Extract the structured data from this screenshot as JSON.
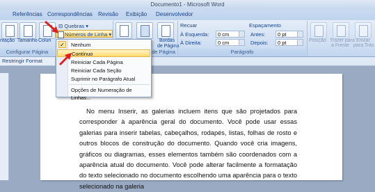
{
  "window": {
    "title": "Documento1 - Microsoft Word"
  },
  "tabs": [
    "Referências",
    "Correspondências",
    "Revisão",
    "Exibição",
    "Desenvolvedor"
  ],
  "ribbon": {
    "quebras_label": "Quebras",
    "numeros_linha_label": "Números de Linha",
    "orientacao_label": "ntação",
    "tamanho_label": "Tamanho",
    "colunas_label": "Colun",
    "bordas_label": "Bordas",
    "de_pagina_label": "de Página",
    "recuar_title": "Recuar",
    "esquerda_label": "À Esquerda:",
    "esquerda_value": "0 cm",
    "direita_label": "À Direita:",
    "direita_value": "0 cm",
    "espacamento_title": "Espaçamento",
    "antes_label": "Antes:",
    "antes_value": "0 pt",
    "depois_label": "Depois:",
    "depois_value": "0 pt",
    "posicao_label": "Posição",
    "trazer_label": "Trazer para",
    "frente_label": "a Frente",
    "enviar_label": "Enviar",
    "tras_label": "para Trás",
    "group_configurar": "Configurar Página",
    "group_fundo": "de Página",
    "group_paragrafo": "Parágrafo"
  },
  "restrict_label": "Restringir Format",
  "dropdown": {
    "items": [
      "Nenhum",
      "Contínuo",
      "Reiniciar Cada Página",
      "Reiniciar Cada Seção",
      "Suprimir no Parágrafo Atual",
      "Opções de Numeração de Linhas..."
    ]
  },
  "document": {
    "paragraph": "No menu Inserir, as galerias incluem itens que são projetados para corresponder à aparência geral do documento. Você pode usar essas galerias para inserir tabelas, cabeçalhos, rodapés, listas, folhas de rosto e outros blocos de construção do documento. Quando você cria imagens, gráficos ou diagramas, esses elementos também são coordenados com a aparência atual do documento. Você pode alterar facilmente a formatação do texto selecionado no documento escolhendo uma aparência para o texto selecionado na galeria"
  },
  "colors": {
    "highlight": "#ffd96b",
    "arrow": "#e02020",
    "ribbon": "#cfdef2"
  }
}
